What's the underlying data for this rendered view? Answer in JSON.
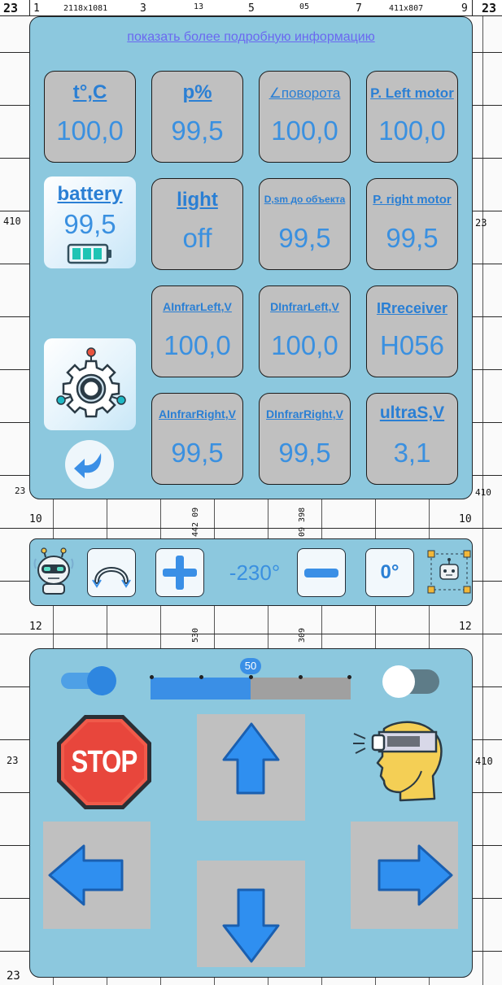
{
  "background": {
    "top_numbers": [
      "23",
      "1",
      "2118x1081",
      "3",
      "13",
      "5",
      "05",
      "7",
      "411x807",
      "9",
      "23"
    ],
    "left_labels": [
      "410",
      "23",
      "10",
      "12",
      "23",
      "23"
    ],
    "right_labels": [
      "23",
      "410",
      "10",
      "12",
      "410"
    ],
    "mid_vertical": [
      "442 09",
      "09 398",
      "530",
      "309"
    ]
  },
  "info_panel": {
    "details_link": "показать более подробную информацию",
    "battery": {
      "label": "battery",
      "value": "99,5",
      "icon": "battery-icon"
    },
    "settings": {
      "icon": "gear-settings-icon"
    },
    "back": {
      "icon": "back-arrow-icon"
    },
    "tiles": [
      {
        "label": "t°,C",
        "value": "100,0"
      },
      {
        "label": "p%",
        "value": "99,5"
      },
      {
        "label": "∠поворота",
        "value": "100,0"
      },
      {
        "label": "P. Left motor",
        "value": "100,0"
      },
      {
        "label": "light",
        "value": "off"
      },
      {
        "label": "D,sm до объекта",
        "value": "99,5"
      },
      {
        "label": "P. right motor",
        "value": "99,5"
      },
      {
        "label": "AInfrarLeft,V",
        "value": "100,0"
      },
      {
        "label": "DInfrarLeft,V",
        "value": "100,0"
      },
      {
        "label": "IRreceiver",
        "value": "H056"
      },
      {
        "label": "AInfrarRight,V",
        "value": "99,5"
      },
      {
        "label": "DInfrarRight,V",
        "value": "99,5"
      },
      {
        "label": "ultraS,V",
        "value": "3,1"
      }
    ]
  },
  "heading_panel": {
    "angle_value": "-230°",
    "reset_label": "0°",
    "icons": [
      "robot-head-icon",
      "rotate-arc-icon",
      "plus-icon",
      "minus-icon",
      "robot-select-icon"
    ]
  },
  "control_panel": {
    "toggle_left_on": true,
    "toggle_right_on": false,
    "slider": {
      "value": 50,
      "min": 0,
      "max": 100
    },
    "stop_label": "STOP",
    "icons": [
      "stop-sign-icon",
      "arrow-up-icon",
      "arrow-left-icon",
      "arrow-right-icon",
      "arrow-down-icon",
      "vr-headset-head-icon"
    ]
  },
  "colors": {
    "panel": "#8cc8de",
    "tile": "#c0c0c0",
    "accent_text": "#3a90e0",
    "arrow": "#2f8ff0",
    "stop_red": "#e8463c",
    "link": "#6a68f0"
  }
}
